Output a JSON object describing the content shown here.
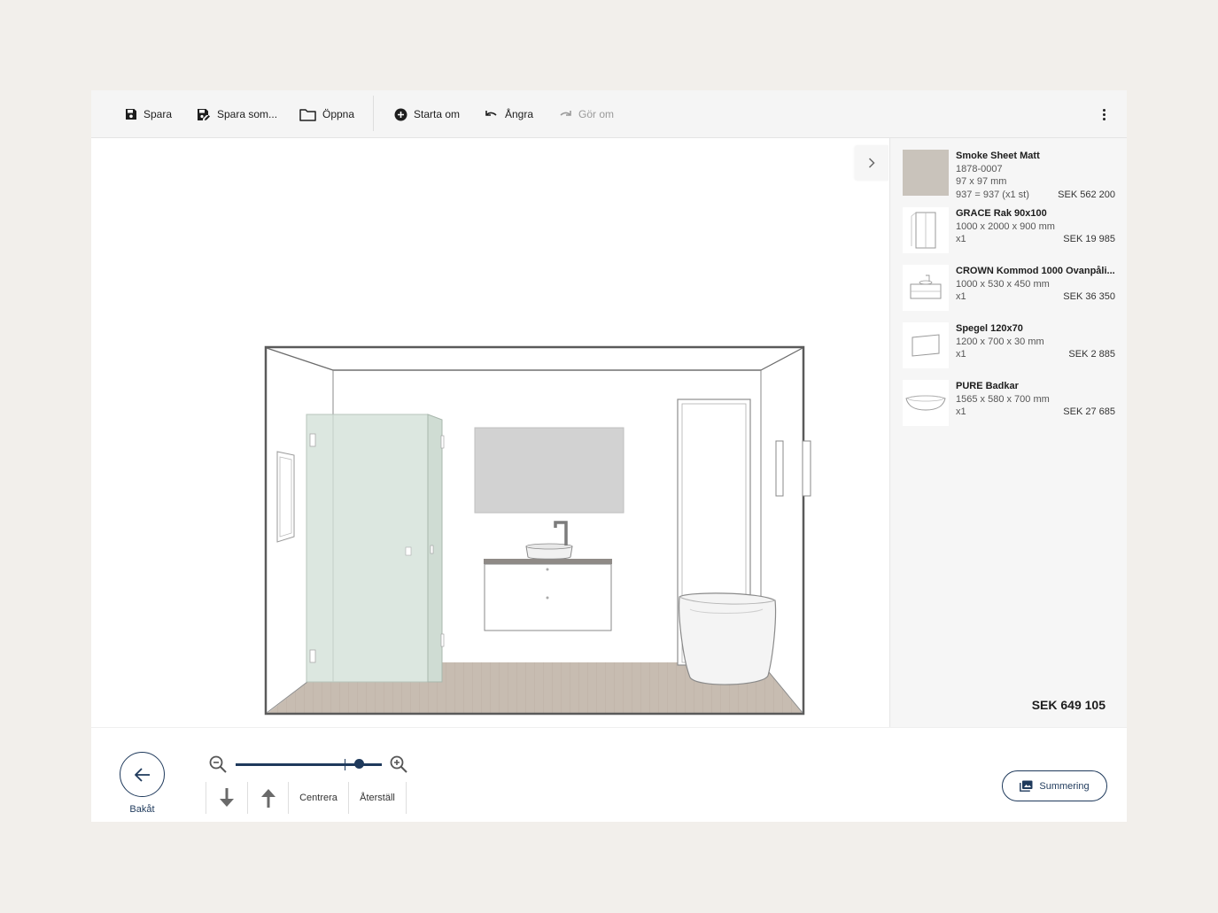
{
  "toolbar": {
    "save": "Spara",
    "save_as": "Spara som...",
    "open": "Öppna",
    "restart": "Starta om",
    "undo": "Ångra",
    "redo": "Gör om"
  },
  "items": [
    {
      "name": "Smoke Sheet Matt",
      "lines": [
        "1878-0007",
        "97 x 97 mm"
      ],
      "qty": "937 = 937 (x1 st)",
      "price": "SEK 562 200",
      "icon": "tile-swatch-icon"
    },
    {
      "name": "GRACE Rak 90x100",
      "lines": [
        "1000 x 2000 x 900 mm"
      ],
      "qty": "x1",
      "price": "SEK 19 985",
      "icon": "shower-enclosure-icon"
    },
    {
      "name": "CROWN Kommod 1000 Ovanpåli...",
      "lines": [
        "1000 x 530 x 450 mm"
      ],
      "qty": "x1",
      "price": "SEK 36 350",
      "icon": "vanity-cabinet-icon"
    },
    {
      "name": "Spegel 120x70",
      "lines": [
        "1200 x 700 x 30 mm"
      ],
      "qty": "x1",
      "price": "SEK 2 885",
      "icon": "mirror-icon"
    },
    {
      "name": "PURE Badkar",
      "lines": [
        "1565 x 580 x 700 mm"
      ],
      "qty": "x1",
      "price": "SEK 27 685",
      "icon": "bathtub-icon"
    }
  ],
  "total": "SEK 649 105",
  "bottom": {
    "back": "Bakåt",
    "center": "Centrera",
    "reset": "Återställ",
    "summary": "Summering",
    "zoom_level": 0.84
  }
}
